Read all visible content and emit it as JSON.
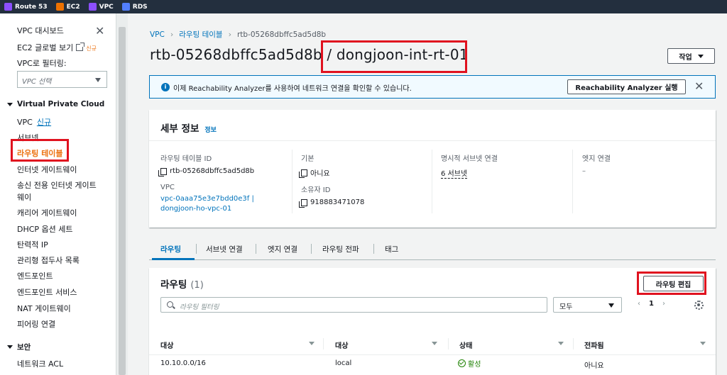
{
  "topbar": {
    "services": [
      {
        "label": "Route 53",
        "icon": "route53-icon",
        "color": "#8c4fff"
      },
      {
        "label": "EC2",
        "icon": "ec2-icon",
        "color": "#ed7100"
      },
      {
        "label": "VPC",
        "icon": "vpc-icon",
        "color": "#8c4fff"
      },
      {
        "label": "RDS",
        "icon": "rds-icon",
        "color": "#527fff"
      }
    ]
  },
  "sidebar": {
    "dashboard": "VPC 대시보드",
    "global_view": "EC2 글로벌 보기",
    "global_view_badge": "신규",
    "filter_label": "VPC로 필터링:",
    "filter_placeholder": "VPC 선택",
    "section_vpc": "Virtual Private Cloud",
    "vpc_item": "VPC",
    "vpc_badge": "신규",
    "items": [
      "서브넷",
      "라우팅 테이블",
      "인터넷 게이트웨이",
      "송신 전용 인터넷 게이트",
      "웨이",
      "캐리어 게이트웨이",
      "DHCP 옵션 세트",
      "탄력적 IP",
      "관리형 접두사 목록",
      "엔드포인트",
      "엔드포인트 서비스",
      "NAT 게이트웨이",
      "피어링 연결"
    ],
    "section_security": "보안",
    "security_items": [
      "네트워크 ACL"
    ]
  },
  "breadcrumb": [
    "VPC",
    "라우팅 테이블",
    "rtb-05268dbffc5ad5d8b"
  ],
  "page_title": "rtb-05268dbffc5ad5d8b / dongjoon-int-rt-01",
  "actions_label": "작업",
  "banner": {
    "text": "이제 Reachability Analyzer를 사용하여 네트워크 연결을 확인할 수 있습니다.",
    "button": "Reachability Analyzer 실행"
  },
  "details": {
    "title": "세부 정보",
    "info": "정보",
    "route_table_id_label": "라우팅 테이블 ID",
    "route_table_id": "rtb-05268dbffc5ad5d8b",
    "main_label": "기본",
    "main_value": "아니요",
    "explicit_label": "명시적 서브넷 연결",
    "explicit_value": "6 서브넷",
    "edge_label": "엣지 연결",
    "edge_value": "–",
    "vpc_label": "VPC",
    "vpc_value_1": "vpc-0aaa75e3e7bdd0e3f |",
    "vpc_value_2": "dongjoon-ho-vpc-01",
    "owner_label": "소유자 ID",
    "owner_value": "918883471078"
  },
  "tabs": [
    "라우팅",
    "서브넷 연결",
    "엣지 연결",
    "라우팅 전파",
    "태그"
  ],
  "routes": {
    "title": "라우팅",
    "count": "(1)",
    "edit_button": "라우팅 편집",
    "filter_placeholder": "라우팅 필터링",
    "select_value": "모두",
    "page": "1",
    "columns": [
      "대상",
      "대상",
      "상태",
      "전파됨"
    ],
    "rows": [
      {
        "destination": "10.10.0.0/16",
        "target": "local",
        "status": "활성",
        "propagated": "아니요"
      }
    ]
  },
  "colors": {
    "accent": "#0073bb",
    "highlight": "#e0121f",
    "active_nav": "#ec7211",
    "success": "#1d8102"
  }
}
